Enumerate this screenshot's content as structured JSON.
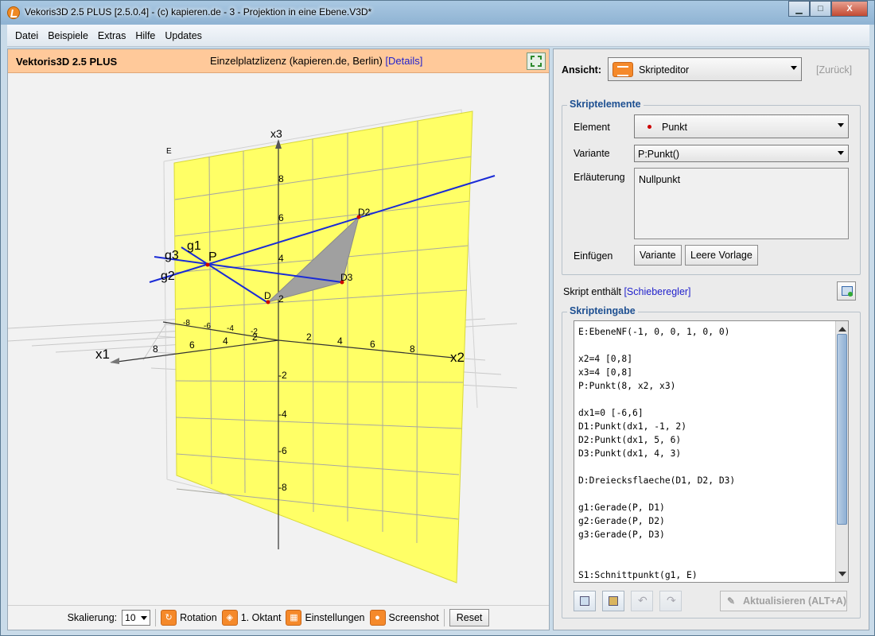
{
  "window": {
    "title": "Vekoris3D 2.5 PLUS [2.5.0.4] - (c) kapieren.de - 3 - Projektion in eine Ebene.V3D*",
    "minimize": "▁",
    "maximize": "□",
    "close": "X"
  },
  "menu": [
    "Datei",
    "Beispiele",
    "Extras",
    "Hilfe",
    "Updates"
  ],
  "header": {
    "brand": "Vektoris3D 2.5 PLUS",
    "license": "Einzelplatzlizenz (kapieren.de, Berlin)",
    "details": "[Details]"
  },
  "scene": {
    "axis_x1": "x1",
    "axis_x2": "x2",
    "axis_x3": "x3",
    "plane_label": "E",
    "labels": {
      "g1": "g1",
      "g2": "g2",
      "g3": "g3",
      "P": "P",
      "D1": "D",
      "D2": "D2",
      "D3": "D3"
    },
    "x3_ticks": [
      "8",
      "6",
      "4",
      "2",
      "-2",
      "-4",
      "-6",
      "-8"
    ],
    "x2_pos_ticks": [
      "2",
      "4",
      "6",
      "8"
    ],
    "x1_pos_ticks": [
      "8",
      "6",
      "4",
      "2"
    ],
    "x1_neg_ticks": [
      "-8",
      "-6",
      "-4",
      "-2"
    ],
    "colors": {
      "plane": "#ffff66",
      "line": "#1a2bd6",
      "triangle": "#a0a0a0",
      "point": "#cc0000"
    }
  },
  "toolbar": {
    "scale_label": "Skalierung:",
    "scale_value": "10",
    "rotation": "Rotation",
    "octant": "1. Oktant",
    "settings": "Einstellungen",
    "screenshot": "Screenshot",
    "reset": "Reset"
  },
  "right": {
    "ansicht_label": "Ansicht:",
    "ansicht_value": "Skripteditor",
    "zurueck": "[Zurück]",
    "elements_legend": "Skriptelemente",
    "element_label": "Element",
    "element_value": "Punkt",
    "variante_label": "Variante",
    "variante_value": "P:Punkt()",
    "erlaeuterung_label": "Erläuterung",
    "erlaeuterung_value": "Nullpunkt",
    "einfuegen_label": "Einfügen",
    "btn_variante": "Variante",
    "btn_leere": "Leere Vorlage",
    "skript_enthaelt": "Skript enthält",
    "skript_link": "[Schieberegler]",
    "input_legend": "Skripteingabe",
    "code": "E:EbeneNF(-1, 0, 0, 1, 0, 0)\n\nx2=4 [0,8]\nx3=4 [0,8]\nP:Punkt(8, x2, x3)\n\ndx1=0 [-6,6]\nD1:Punkt(dx1, -1, 2)\nD2:Punkt(dx1, 5, 6)\nD3:Punkt(dx1, 4, 3)\n\nD:Dreiecksflaeche(D1, D2, D3)\n\ng1:Gerade(P, D1)\ng2:Gerade(P, D2)\ng3:Gerade(P, D3)\n\n\nS1:Schnittpunkt(g1, E)",
    "aktualisieren": "Aktualisieren (ALT+A)"
  }
}
